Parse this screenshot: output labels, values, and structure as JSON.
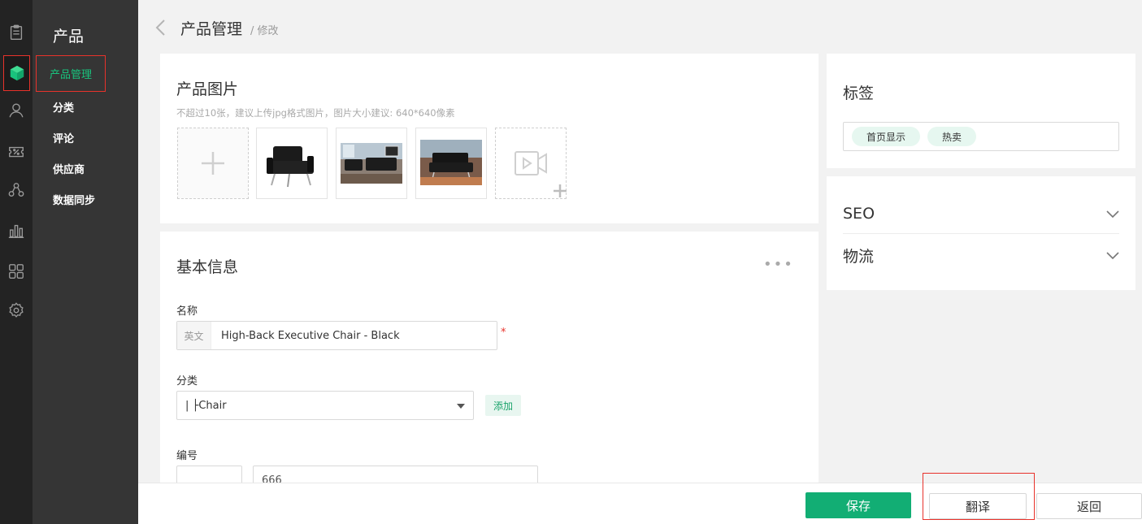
{
  "sidebar": {
    "section_title": "产品",
    "items": [
      {
        "label": "产品管理"
      },
      {
        "label": "分类"
      },
      {
        "label": "评论"
      },
      {
        "label": "供应商"
      },
      {
        "label": "数据同步"
      }
    ]
  },
  "rail_icons": [
    "clipboard-icon",
    "cube-icon",
    "user-icon",
    "discount-icon",
    "group-icon",
    "bar-chart-icon",
    "apps-icon",
    "settings-icon"
  ],
  "header": {
    "title": "产品管理",
    "crumb": "/ 修改"
  },
  "images_card": {
    "title": "产品图片",
    "hint": "不超过10张，建议上传jpg格式图片，图片大小建议: 640*640像素"
  },
  "basic_card": {
    "title": "基本信息",
    "more": "•••",
    "name_label": "名称",
    "name_prefix": "英文",
    "name_value": "High-Back Executive Chair - Black",
    "required": "*",
    "category_label": "分类",
    "category_value": "| ├Chair",
    "add_label": "添加",
    "sku_label": "编号",
    "sku_value": "666"
  },
  "tags_card": {
    "title": "标签",
    "tags": [
      "首页显示",
      "热卖"
    ]
  },
  "accordion": [
    {
      "label": "SEO"
    },
    {
      "label": "物流"
    }
  ],
  "footer": {
    "save": "保存",
    "translate": "翻译",
    "back": "返回"
  },
  "colors": {
    "accent": "#12ae74",
    "highlight": "#e8322b",
    "rail": "#232323",
    "sidebar": "#353535"
  }
}
